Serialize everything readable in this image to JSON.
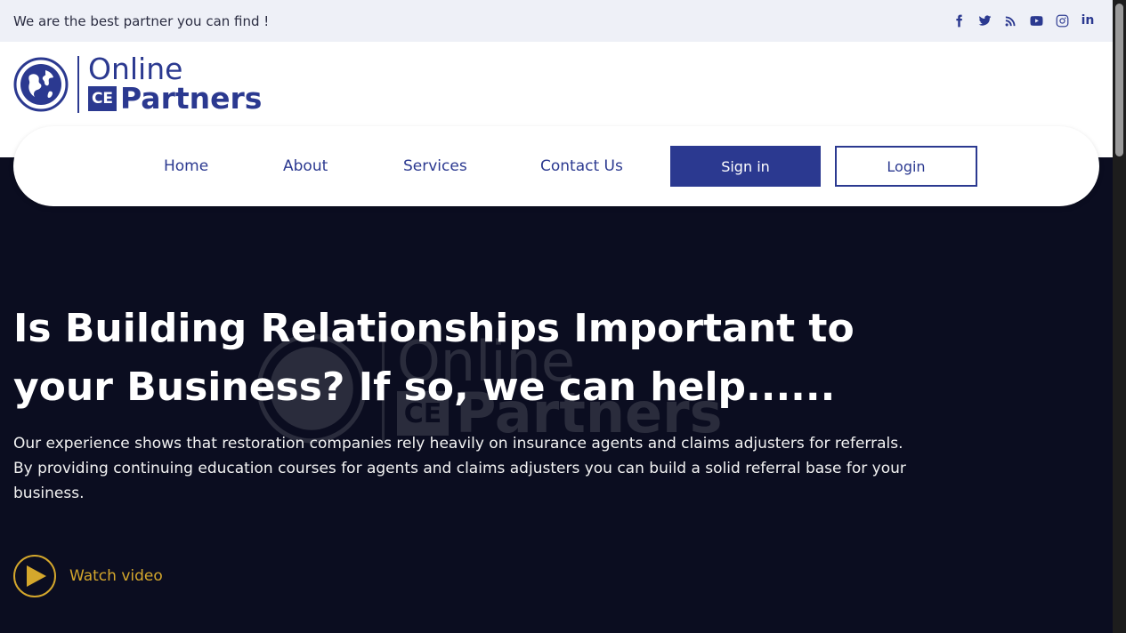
{
  "topbar": {
    "tagline": "We are the best partner you can find !",
    "social": [
      "facebook-icon",
      "twitter-icon",
      "rss-icon",
      "youtube-icon",
      "instagram-icon",
      "linkedin-icon"
    ]
  },
  "logo": {
    "line1": "Online",
    "badge": "CE",
    "line2": "Partners"
  },
  "nav": {
    "items": [
      "Home",
      "About",
      "Services",
      "Contact Us"
    ],
    "signin": "Sign in",
    "login": "Login"
  },
  "hero": {
    "headline": "Is Building Relationships Important to your Business? If so, we can help......",
    "description": "Our experience shows that restoration companies rely heavily on insurance agents and claims adjusters for referrals. By providing continuing education courses for agents and claims adjusters you can build a solid referral base for your business.",
    "watch_label": "Watch video"
  },
  "colors": {
    "brand": "#2b3990",
    "hero_bg": "#0b0d20",
    "accent": "#d4a72c",
    "topbar_bg": "#eef0f7"
  }
}
